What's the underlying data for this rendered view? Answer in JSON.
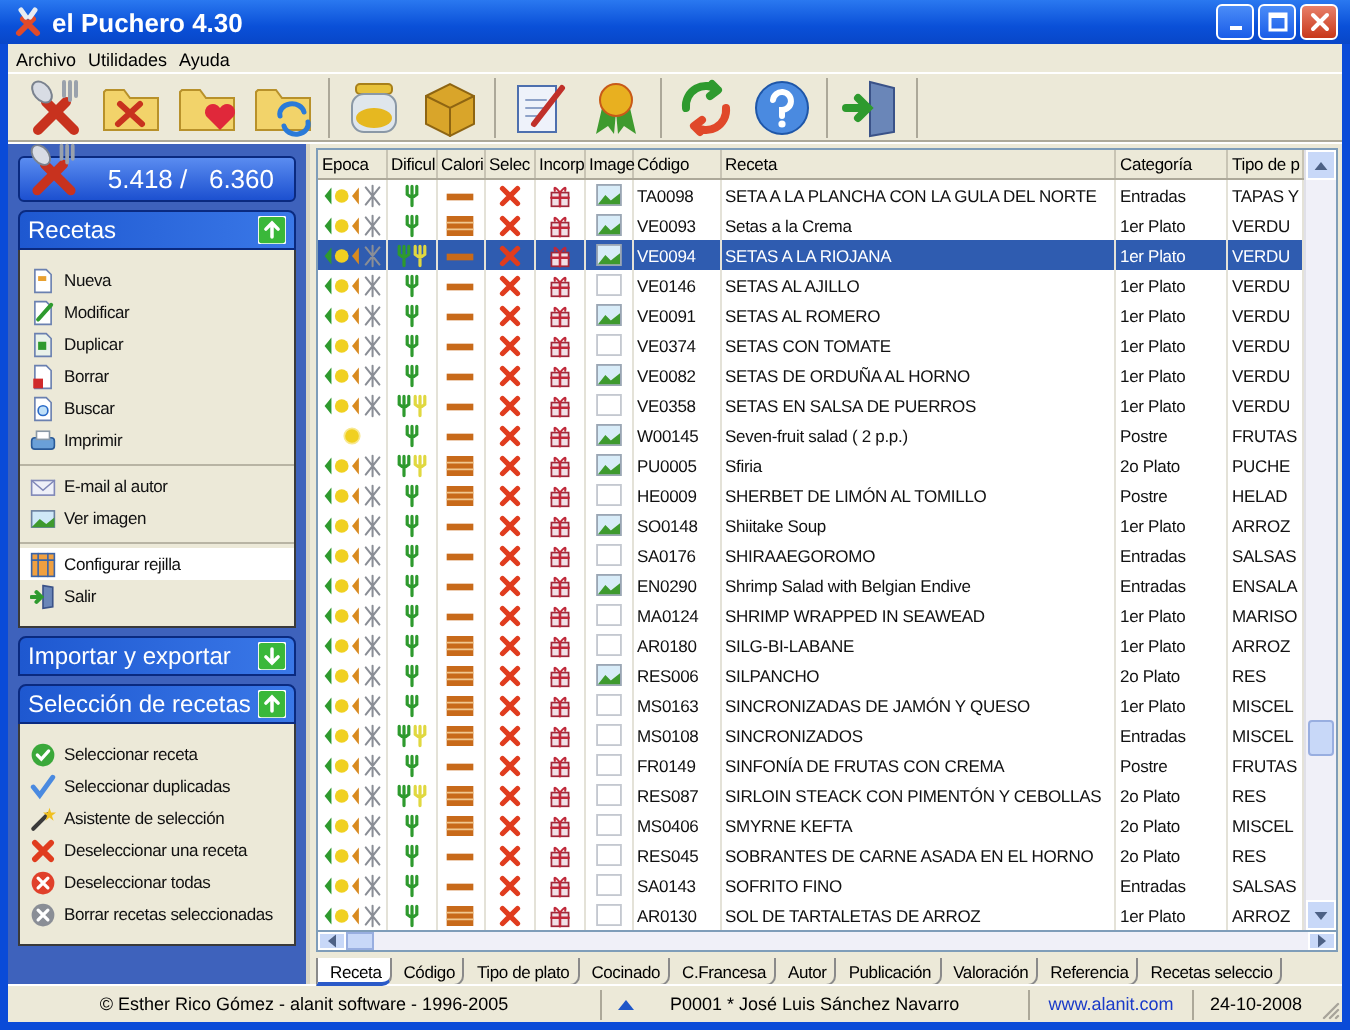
{
  "window": {
    "title": "el Puchero 4.30"
  },
  "menu": [
    "Archivo",
    "Utilidades",
    "Ayuda"
  ],
  "counter": "5.418 /   6.360",
  "panels": [
    {
      "title": "Recetas",
      "expanded": true,
      "groups": [
        [
          {
            "label": "Nueva",
            "selected": false
          },
          {
            "label": "Modificar",
            "selected": false
          },
          {
            "label": "Duplicar",
            "selected": false
          },
          {
            "label": "Borrar",
            "selected": false
          },
          {
            "label": "Buscar",
            "selected": false
          },
          {
            "label": "Imprimir",
            "selected": false
          }
        ],
        [
          {
            "label": "E-mail al autor",
            "selected": false
          },
          {
            "label": "Ver imagen",
            "selected": false
          }
        ],
        [
          {
            "label": "Configurar rejilla",
            "selected": true
          },
          {
            "label": "Salir",
            "selected": false
          }
        ]
      ]
    },
    {
      "title": "Importar y exportar",
      "expanded": false
    },
    {
      "title": "Selección de recetas",
      "expanded": true,
      "groups": [
        [
          {
            "label": "Seleccionar receta",
            "selected": false
          },
          {
            "label": "Seleccionar duplicadas",
            "selected": false
          },
          {
            "label": "Asistente de selección",
            "selected": false
          },
          {
            "label": "Deseleccionar una receta",
            "selected": false
          },
          {
            "label": "Deseleccionar todas",
            "selected": false
          },
          {
            "label": "Borrar recetas seleccionadas",
            "selected": false
          }
        ]
      ]
    }
  ],
  "table": {
    "columns": [
      "Epoca",
      "Dificul",
      "Calori",
      "Selec",
      "Incorp",
      "Image",
      "Código",
      "Receta",
      "Categoría",
      "Tipo de p"
    ],
    "rows": [
      {
        "summer_only": false,
        "hard": false,
        "high_calorie": false,
        "marked": false,
        "has_image": true,
        "code": "TA0098",
        "recipe": "SETA A LA PLANCHA CON LA GULA DEL NORTE",
        "category": "Entradas",
        "type": "TAPAS Y",
        "selected": false
      },
      {
        "summer_only": false,
        "hard": false,
        "high_calorie": true,
        "marked": false,
        "has_image": true,
        "code": "VE0093",
        "recipe": "Setas a la Crema",
        "category": "1er Plato",
        "type": "VERDU",
        "selected": false
      },
      {
        "summer_only": false,
        "hard": true,
        "high_calorie": false,
        "marked": false,
        "has_image": true,
        "code": "VE0094",
        "recipe": "SETAS A LA RIOJANA",
        "category": "1er Plato",
        "type": "VERDU",
        "selected": true
      },
      {
        "summer_only": false,
        "hard": false,
        "high_calorie": false,
        "marked": false,
        "has_image": false,
        "code": "VE0146",
        "recipe": "SETAS AL AJILLO",
        "category": "1er Plato",
        "type": "VERDU",
        "selected": false
      },
      {
        "summer_only": false,
        "hard": false,
        "high_calorie": false,
        "marked": false,
        "has_image": true,
        "code": "VE0091",
        "recipe": "SETAS AL ROMERO",
        "category": "1er Plato",
        "type": "VERDU",
        "selected": false
      },
      {
        "summer_only": false,
        "hard": false,
        "high_calorie": false,
        "marked": false,
        "has_image": false,
        "code": "VE0374",
        "recipe": "SETAS CON TOMATE",
        "category": "1er Plato",
        "type": "VERDU",
        "selected": false
      },
      {
        "summer_only": false,
        "hard": false,
        "high_calorie": false,
        "marked": false,
        "has_image": true,
        "code": "VE0082",
        "recipe": "SETAS DE ORDUÑA AL HORNO",
        "category": "1er Plato",
        "type": "VERDU",
        "selected": false
      },
      {
        "summer_only": false,
        "hard": true,
        "high_calorie": false,
        "marked": false,
        "has_image": false,
        "code": "VE0358",
        "recipe": "SETAS EN SALSA DE PUERROS",
        "category": "1er Plato",
        "type": "VERDU",
        "selected": false
      },
      {
        "summer_only": true,
        "hard": false,
        "high_calorie": false,
        "marked": false,
        "has_image": true,
        "code": "W00145",
        "recipe": "Seven-fruit salad ( 2 p.p.)",
        "category": "Postre",
        "type": "FRUTAS",
        "selected": false
      },
      {
        "summer_only": false,
        "hard": true,
        "high_calorie": true,
        "marked": false,
        "has_image": true,
        "code": "PU0005",
        "recipe": "Sfiria",
        "category": "2o Plato",
        "type": "PUCHE",
        "selected": false
      },
      {
        "summer_only": false,
        "hard": false,
        "high_calorie": true,
        "marked": false,
        "has_image": false,
        "code": "HE0009",
        "recipe": "SHERBET DE LIMÓN AL TOMILLO",
        "category": "Postre",
        "type": "HELAD",
        "selected": false
      },
      {
        "summer_only": false,
        "hard": false,
        "high_calorie": false,
        "marked": false,
        "has_image": true,
        "code": "SO0148",
        "recipe": "Shiitake Soup",
        "category": "1er Plato",
        "type": "ARROZ",
        "selected": false
      },
      {
        "summer_only": false,
        "hard": false,
        "high_calorie": false,
        "marked": false,
        "has_image": false,
        "code": "SA0176",
        "recipe": "SHIRAAEGOROMO",
        "category": "Entradas",
        "type": "SALSAS",
        "selected": false
      },
      {
        "summer_only": false,
        "hard": false,
        "high_calorie": false,
        "marked": false,
        "has_image": true,
        "code": "EN0290",
        "recipe": "Shrimp Salad with Belgian Endive",
        "category": "Entradas",
        "type": "ENSALA",
        "selected": false
      },
      {
        "summer_only": false,
        "hard": false,
        "high_calorie": false,
        "marked": false,
        "has_image": false,
        "code": "MA0124",
        "recipe": "SHRIMP WRAPPED IN SEAWEAD",
        "category": "1er Plato",
        "type": "MARISO",
        "selected": false
      },
      {
        "summer_only": false,
        "hard": false,
        "high_calorie": true,
        "marked": false,
        "has_image": false,
        "code": "AR0180",
        "recipe": "SILG-BI-LABANE",
        "category": "1er Plato",
        "type": "ARROZ",
        "selected": false
      },
      {
        "summer_only": false,
        "hard": false,
        "high_calorie": true,
        "marked": false,
        "has_image": true,
        "code": "RES006",
        "recipe": "SILPANCHO",
        "category": "2o Plato",
        "type": "RES",
        "selected": false
      },
      {
        "summer_only": false,
        "hard": false,
        "high_calorie": true,
        "marked": false,
        "has_image": false,
        "code": "MS0163",
        "recipe": "SINCRONIZADAS DE JAMÓN Y QUESO",
        "category": "1er Plato",
        "type": "MISCEL",
        "selected": false
      },
      {
        "summer_only": false,
        "hard": true,
        "high_calorie": true,
        "marked": false,
        "has_image": false,
        "code": "MS0108",
        "recipe": "SINCRONIZADOS",
        "category": "Entradas",
        "type": "MISCEL",
        "selected": false
      },
      {
        "summer_only": false,
        "hard": false,
        "high_calorie": false,
        "marked": false,
        "has_image": false,
        "code": "FR0149",
        "recipe": "SINFONÍA DE FRUTAS CON CREMA",
        "category": "Postre",
        "type": "FRUTAS",
        "selected": false
      },
      {
        "summer_only": false,
        "hard": true,
        "high_calorie": true,
        "marked": false,
        "has_image": false,
        "code": "RES087",
        "recipe": "SIRLOIN STEACK CON PIMENTÓN Y CEBOLLAS",
        "category": "2o Plato",
        "type": "RES",
        "selected": false
      },
      {
        "summer_only": false,
        "hard": false,
        "high_calorie": true,
        "marked": false,
        "has_image": false,
        "code": "MS0406",
        "recipe": "SMYRNE KEFTA",
        "category": "2o Plato",
        "type": "MISCEL",
        "selected": false
      },
      {
        "summer_only": false,
        "hard": false,
        "high_calorie": false,
        "marked": false,
        "has_image": false,
        "code": "RES045",
        "recipe": "SOBRANTES DE CARNE ASADA EN EL HORNO",
        "category": "2o Plato",
        "type": "RES",
        "selected": false
      },
      {
        "summer_only": false,
        "hard": false,
        "high_calorie": false,
        "marked": false,
        "has_image": false,
        "code": "SA0143",
        "recipe": "SOFRITO FINO",
        "category": "Entradas",
        "type": "SALSAS",
        "selected": false
      },
      {
        "summer_only": false,
        "hard": false,
        "high_calorie": true,
        "marked": false,
        "has_image": false,
        "code": "AR0130",
        "recipe": "SOL DE TARTALETAS DE ARROZ",
        "category": "1er Plato",
        "type": "ARROZ",
        "selected": false
      }
    ]
  },
  "tabs": [
    {
      "label": "Receta",
      "selected": true
    },
    {
      "label": "Código",
      "selected": false
    },
    {
      "label": "Tipo de plato",
      "selected": false
    },
    {
      "label": "Cocinado",
      "selected": false
    },
    {
      "label": "C.Francesa",
      "selected": false
    },
    {
      "label": "Autor",
      "selected": false
    },
    {
      "label": "Publicación",
      "selected": false
    },
    {
      "label": "Valoración",
      "selected": false
    },
    {
      "label": "Referencia",
      "selected": false
    },
    {
      "label": "Recetas seleccio",
      "selected": false
    }
  ],
  "status_bar": {
    "copyright": "© Esther Rico Gómez - alanit software - 1996-2005",
    "user": "P0001 * José Luis Sánchez Navarro",
    "website": "www.alanit.com",
    "date": "24-10-2008"
  }
}
